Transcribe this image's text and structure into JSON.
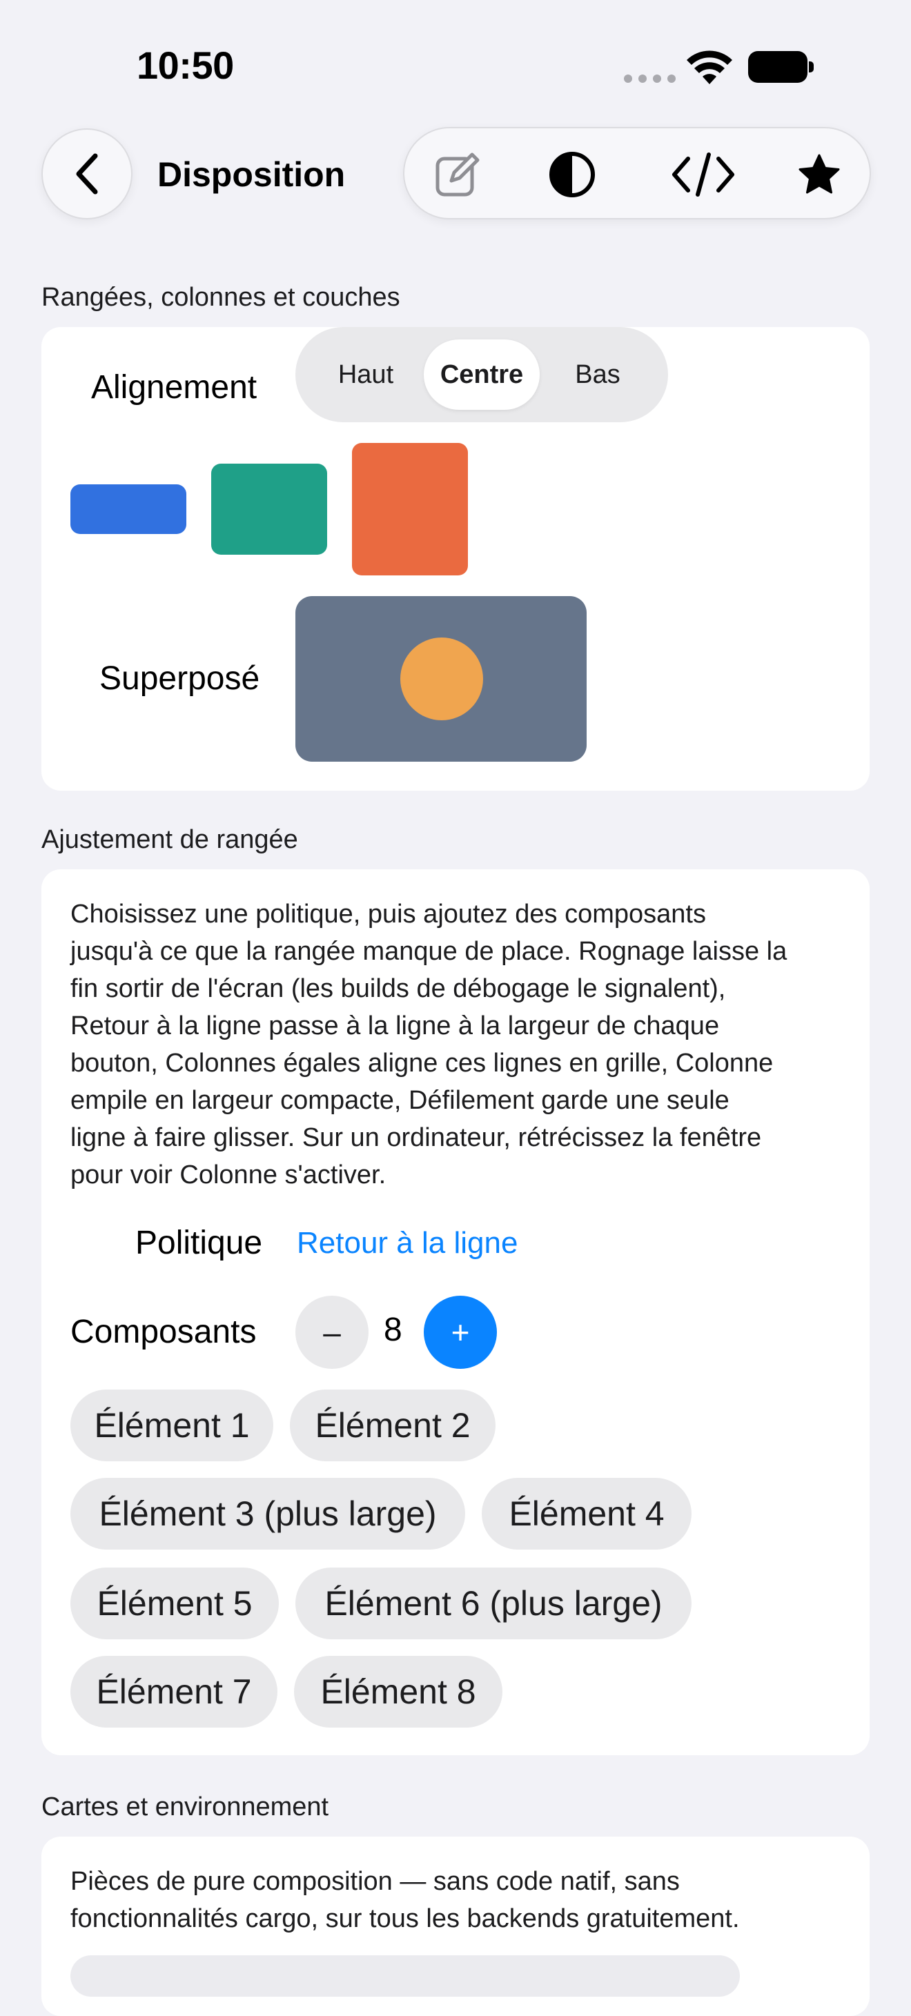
{
  "status_bar": {
    "time": "10:50"
  },
  "nav": {
    "title": "Disposition"
  },
  "toolbar": {
    "icons": [
      "edit-icon",
      "contrast-icon",
      "code-icon",
      "star-icon"
    ]
  },
  "section1": {
    "header": "Rangées, colonnes et couches",
    "alignment_label": "Alignement",
    "segments": [
      "Haut",
      "Centre",
      "Bas"
    ],
    "selected_segment": "Centre",
    "overlay_label": "Superposé",
    "colors": {
      "blue": "#3171e0",
      "green": "#1fa088",
      "orange": "#ea6a40",
      "slate": "#66758b",
      "amber": "#f0a54f"
    }
  },
  "section2": {
    "header": "Ajustement de rangée",
    "description_lines": [
      "Choisissez une politique, puis ajoutez des composants",
      "jusqu'à ce que la rangée manque de place. Rognage laisse la",
      "fin sortir de l'écran (les builds de débogage le signalent),",
      "Retour à la ligne passe à la ligne à la largeur de chaque",
      "bouton, Colonnes égales aligne ces lignes en grille, Colonne",
      "empile en largeur compacte, Défilement garde une seule",
      "ligne à faire glisser. Sur un ordinateur, rétrécissez la fenêtre",
      "pour voir Colonne s'activer."
    ],
    "policy_label": "Politique",
    "policy_value": "Retour à la ligne",
    "components_label": "Composants",
    "minus_label": "–",
    "plus_label": "+",
    "component_count": "8",
    "items": [
      "Élément 1",
      "Élément 2",
      "Élément 3 (plus large)",
      "Élément 4",
      "Élément 5",
      "Élément 6 (plus large)",
      "Élément 7",
      "Élément 8"
    ]
  },
  "section3": {
    "header": "Cartes et environnement",
    "description_lines": [
      "Pièces de pure composition — sans code natif, sans",
      "fonctionnalités cargo, sur tous les backends gratuitement."
    ]
  }
}
